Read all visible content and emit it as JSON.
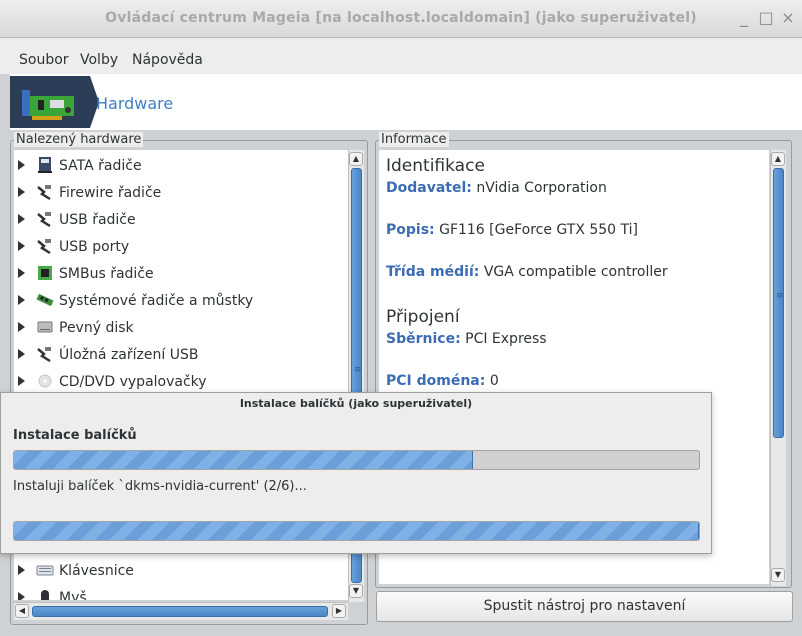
{
  "window": {
    "title": "Ovládací centrum Mageia  [na localhost.localdomain] (jako superuživatel)",
    "buttons": [
      "_",
      "□",
      "×"
    ]
  },
  "menu": {
    "items": [
      {
        "label": "Soubor",
        "mnemonic": "S"
      },
      {
        "label": "Volby",
        "mnemonic": "V"
      },
      {
        "label": "Nápověda",
        "mnemonic": "N"
      }
    ]
  },
  "banner": {
    "title": "Hardware",
    "icon": "hardware-card-icon",
    "colors": {
      "logo_bg": "#2c3e57",
      "title": "#3e7fc1"
    }
  },
  "left_panel": {
    "frame_label": "Nalezený hardware",
    "items": [
      {
        "label": "SATA řadiče",
        "icon": "disk-controller-icon"
      },
      {
        "label": "Firewire řadiče",
        "icon": "plug-icon"
      },
      {
        "label": "USB řadiče",
        "icon": "plug-icon"
      },
      {
        "label": "USB porty",
        "icon": "plug-icon"
      },
      {
        "label": "SMBus řadiče",
        "icon": "chip-icon"
      },
      {
        "label": "Systémové řadiče a můstky",
        "icon": "memory-icon"
      },
      {
        "label": "Pevný disk",
        "icon": "harddisk-icon"
      },
      {
        "label": "Úložná zařízení USB",
        "icon": "plug-icon"
      },
      {
        "label": "CD/DVD vypalovačky",
        "icon": "cd-icon"
      },
      {
        "label": "Klávesnice",
        "icon": "keyboard-icon"
      },
      {
        "label": "Myš",
        "icon": "mouse-icon"
      }
    ]
  },
  "right_panel": {
    "frame_label": "Informace",
    "sections": [
      {
        "heading": "Identifikace"
      },
      {
        "heading": "Připojení"
      }
    ],
    "fields": [
      {
        "key": "Dodavatel:",
        "value": "nVidia Corporation"
      },
      {
        "key": "Popis:",
        "value": "GF116 [GeForce GTX 550 Ti]"
      },
      {
        "key": "Třída médií:",
        "value": "VGA compatible controller"
      },
      {
        "key": "Sběrnice:",
        "value": "PCI Express"
      },
      {
        "key": "PCI doména:",
        "value": "0"
      }
    ],
    "action_button": "Spustit nástroj pro nastavení"
  },
  "dialog": {
    "title": "Instalace balíčků (jako superuživatel)",
    "heading": "Instalace balíčků",
    "status": "Instaluji balíček `dkms-nvidia-current' (2/6)...",
    "progress_main": 0.67,
    "progress_secondary": 1.0
  }
}
